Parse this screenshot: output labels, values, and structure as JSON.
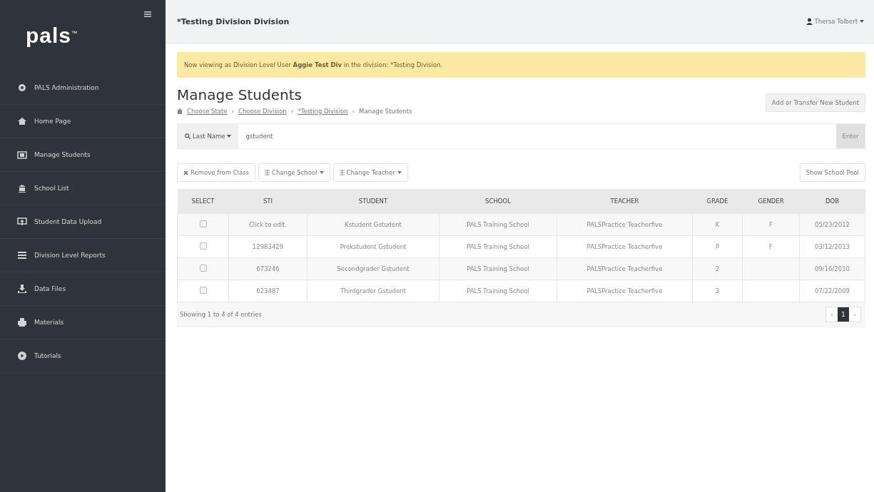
{
  "sidebar": {
    "logo": "pals",
    "logo_mark": "™",
    "items": [
      {
        "label": "PALS Administration"
      },
      {
        "label": "Home Page"
      },
      {
        "label": "Manage Students"
      },
      {
        "label": "School List"
      },
      {
        "label": "Student Data Upload"
      },
      {
        "label": "Division Level Reports"
      },
      {
        "label": "Data Files"
      },
      {
        "label": "Materials"
      },
      {
        "label": "Tutorials"
      }
    ]
  },
  "topbar": {
    "title": "*Testing Division Division",
    "user": "Thersa Tolbert"
  },
  "alert": "Now viewing as Division Level User **Aggie Test Div** in the division: *Testing Division.",
  "page_title": "Manage Students",
  "add_button": "Add or Transfer New Student",
  "breadcrumb": [
    {
      "label": "Choose State",
      "link": true
    },
    {
      "label": "Choose Division",
      "link": true
    },
    {
      "label": "*Testing Division",
      "link": true
    },
    {
      "label": "Manage Students",
      "link": false
    }
  ],
  "breadcrumb_separator": "›",
  "search": {
    "filter": "Last Name",
    "value": "gstudent",
    "button": "Enter"
  },
  "actions": [
    {
      "label": "Remove from Class",
      "dropdown": false
    },
    {
      "label": "Change School",
      "dropdown": true
    },
    {
      "label": "Change Teacher",
      "dropdown": true
    }
  ],
  "pool_button": "Show School Pool",
  "table": {
    "columns": [
      "SELECT",
      "STI",
      "STUDENT",
      "SCHOOL",
      "TEACHER",
      "GRADE",
      "GENDER",
      "DOB"
    ],
    "rows": [
      {
        "checked": false,
        "cells": [
          "",
          "Click to edit.",
          "Kstudent Gstudent",
          "PALS Training School",
          "PALSPractice Teacherfive",
          "K",
          "F",
          "05/23/2012"
        ]
      },
      {
        "checked": false,
        "cells": [
          "",
          "12983429",
          "Prekstudent Gstudent",
          "PALS Training School",
          "PALSPractice Teacherfive",
          "P",
          "F",
          "03/12/2013"
        ]
      },
      {
        "checked": false,
        "cells": [
          "",
          "673246",
          "Secondgrader Gstudent",
          "PALS Training School",
          "PALSPractice Teacherfive",
          "2",
          "",
          "09/16/2010"
        ]
      },
      {
        "checked": false,
        "cells": [
          "",
          "623487",
          "Thirdgrader Gstudent",
          "PALS Training School",
          "PALSPractice Teacherfive",
          "3",
          "",
          "07/22/2009"
        ]
      }
    ]
  },
  "footer": "Showing 1 to 4 of 4 entries",
  "pagination": [
    {
      "label": "‹",
      "selected": false
    },
    {
      "label": "1",
      "selected": true
    },
    {
      "label": "›",
      "selected": false
    }
  ]
}
